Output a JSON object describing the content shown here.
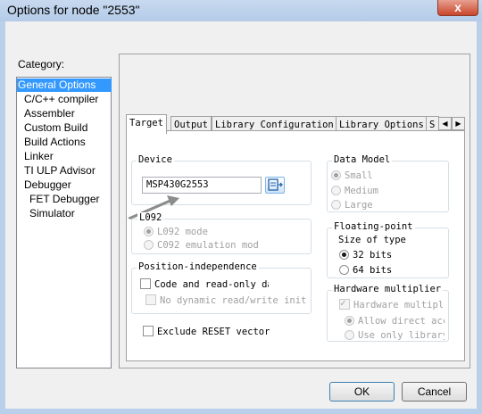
{
  "window": {
    "title": "Options for node \"2553\"",
    "close_glyph": "x"
  },
  "category": {
    "label": "Category:",
    "items": [
      {
        "label": "General Options",
        "selected": true
      },
      {
        "label": "C/C++ compiler"
      },
      {
        "label": "Assembler"
      },
      {
        "label": "Custom Build"
      },
      {
        "label": "Build Actions"
      },
      {
        "label": "Linker"
      },
      {
        "label": "TI ULP Advisor"
      },
      {
        "label": "Debugger"
      },
      {
        "label": "FET Debugger"
      },
      {
        "label": "Simulator"
      }
    ]
  },
  "tabs": [
    "Target",
    "Output",
    "Library Configuration",
    "Library Options",
    "S"
  ],
  "device": {
    "group": "Device",
    "value": "MSP430G2553"
  },
  "l092": {
    "group": "L092",
    "opt1": "L092 mode",
    "opt2": "C092 emulation mod"
  },
  "position_independence": {
    "group": "Position-independence",
    "opt1": "Code and read-only da",
    "opt2": "No dynamic read/write initi"
  },
  "exclude_reset": "Exclude RESET vector",
  "data_model": {
    "group": "Data Model",
    "options": [
      "Small",
      "Medium",
      "Large"
    ]
  },
  "floating_point": {
    "group": "Floating-point",
    "size_label": "Size of type",
    "options": [
      "32 bits",
      "64 bits"
    ],
    "selected": "32 bits"
  },
  "hardware_multiplier": {
    "group": "Hardware multiplier",
    "opt": "Hardware multipli",
    "sub": [
      "Allow direct acc",
      "Use only library"
    ]
  },
  "buttons": {
    "ok": "OK",
    "cancel": "Cancel"
  },
  "colors": {
    "selection": "#3399ff",
    "titlebar": "#b9cfea"
  }
}
